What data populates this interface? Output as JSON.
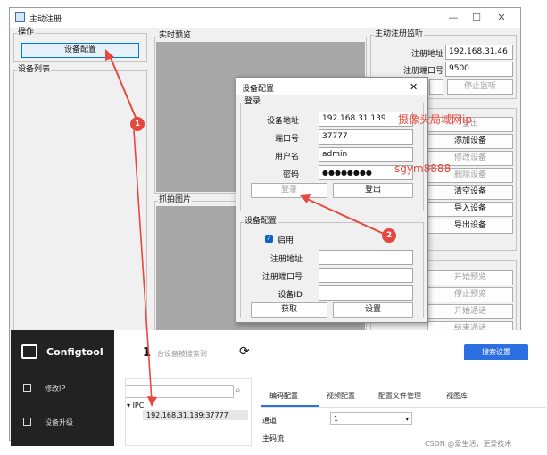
{
  "window": {
    "title": "主动注册",
    "minimize": "—",
    "maximize": "☐",
    "close": "✕"
  },
  "ops": {
    "group_label": "操作",
    "config_button": "设备配置"
  },
  "device_list": {
    "label": "设备列表"
  },
  "preview": {
    "label": "实时预览"
  },
  "capture": {
    "label": "抓拍图片"
  },
  "listen": {
    "group_label": "主动注册监听",
    "addr_label": "注册地址",
    "addr_value": "192.168.31.46",
    "port_label": "注册端口号",
    "port_value": "9500",
    "start_button": "",
    "stop_button": "停止监听"
  },
  "right_buttons": [
    "登出",
    "添加设备",
    "修改设备",
    "删除设备",
    "清空设备",
    "导入设备",
    "导出设备"
  ],
  "right_buttons_disabled": [
    true,
    false,
    true,
    true,
    false,
    false,
    false
  ],
  "preview_buttons": [
    "开始预览",
    "停止预览",
    "开始通话",
    "结束通话"
  ],
  "dialog": {
    "title": "设备配置",
    "close": "✕",
    "login_group": "登录",
    "addr_label": "设备地址",
    "addr_value": "192.168.31.139",
    "port_label": "端口号",
    "port_value": "37777",
    "user_label": "用户名",
    "user_value": "admin",
    "pwd_label": "密码",
    "pwd_value": "●●●●●●●●",
    "login_button": "登录",
    "logout_button": "登出",
    "config_group": "设备配置",
    "enable_label": "启用",
    "reg_addr_label": "注册地址",
    "reg_addr_value": "",
    "reg_port_label": "注册端口号",
    "reg_port_value": "",
    "device_id_label": "设备ID",
    "device_id_value": "",
    "get_button": "获取",
    "set_button": "设置"
  },
  "annotations": {
    "camera_ip": "摄像头局域网ip",
    "password": "sgym8888",
    "marker1": "1",
    "marker2": "2"
  },
  "configtool": {
    "logo": "Configtool",
    "nav": [
      {
        "label": "修改IP",
        "icon": "edit-icon"
      },
      {
        "label": "设备升级",
        "icon": "upgrade-icon"
      }
    ],
    "count": "1",
    "search_hint": "台设备被搜索到",
    "search_settings": "搜索设置",
    "tree_root": "IPC",
    "tree_item": "192.168.31.139:37777",
    "tabs": [
      "编码配置",
      "视频配置",
      "配置文件管理",
      "视图库"
    ],
    "channel_label": "通道",
    "channel_value": "1",
    "main_stream": "主码流"
  },
  "watermark": "CSDN @爱生活，更爱技术",
  "colors": {
    "accent_blue": "#2b6fe0",
    "annot_red": "#e8483f",
    "dark_side": "#222222"
  }
}
